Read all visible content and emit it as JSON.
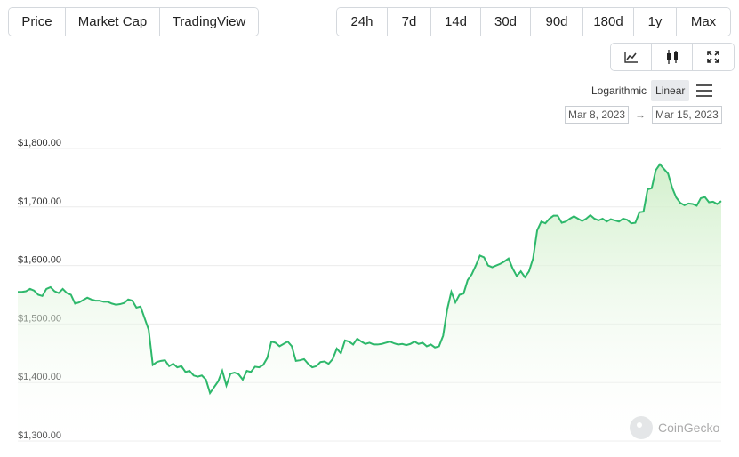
{
  "tabs": [
    {
      "label": "Price",
      "active": true
    },
    {
      "label": "Market Cap",
      "active": false
    },
    {
      "label": "TradingView",
      "active": false
    }
  ],
  "ranges": [
    {
      "label": "24h",
      "active": false
    },
    {
      "label": "7d",
      "active": true
    },
    {
      "label": "14d",
      "active": false
    },
    {
      "label": "30d",
      "active": false
    },
    {
      "label": "90d",
      "active": false
    },
    {
      "label": "180d",
      "active": false
    },
    {
      "label": "1y",
      "active": false
    },
    {
      "label": "Max",
      "active": false
    }
  ],
  "chart_types": [
    {
      "icon": "line-chart-icon",
      "active": true
    },
    {
      "icon": "candlestick-icon",
      "active": false
    },
    {
      "icon": "fullscreen-icon",
      "active": false
    }
  ],
  "scale": {
    "logarithmic": "Logarithmic",
    "linear": "Linear",
    "selected": "Linear"
  },
  "date_range": {
    "from": "Mar 8, 2023",
    "arrow": "→",
    "to": "Mar 15, 2023"
  },
  "watermark": "CoinGecko",
  "colors": {
    "line": "#2eb86b",
    "area_top": "#cdeec6",
    "accent_active": "#6aa84f"
  },
  "chart_data": {
    "type": "area",
    "title": "",
    "xlabel": "",
    "ylabel": "",
    "ylim": [
      1300,
      1800
    ],
    "yticks": [
      1300,
      1400,
      1500,
      1600,
      1700,
      1800
    ],
    "ytick_labels": [
      "$1,300.00",
      "$1,400.00",
      "$1,500.00",
      "$1,600.00",
      "$1,700.00",
      "$1,800.00"
    ],
    "x_start": "Mar 8, 2023",
    "x_end": "Mar 15, 2023",
    "grid": true,
    "series": [
      {
        "values": [
          1555,
          1555,
          1556,
          1560,
          1557,
          1550,
          1548,
          1560,
          1563,
          1556,
          1553,
          1560,
          1553,
          1550,
          1535,
          1537,
          1541,
          1545,
          1542,
          1540,
          1540,
          1538,
          1538,
          1535,
          1533,
          1534,
          1536,
          1542,
          1540,
          1528,
          1530,
          1510,
          1490,
          1430,
          1435,
          1437,
          1438,
          1428,
          1432,
          1426,
          1428,
          1418,
          1420,
          1412,
          1410,
          1412,
          1405,
          1382,
          1392,
          1402,
          1420,
          1395,
          1415,
          1417,
          1414,
          1405,
          1420,
          1418,
          1427,
          1426,
          1430,
          1442,
          1470,
          1468,
          1462,
          1466,
          1470,
          1462,
          1437,
          1438,
          1440,
          1432,
          1426,
          1428,
          1435,
          1436,
          1432,
          1440,
          1458,
          1450,
          1472,
          1470,
          1465,
          1475,
          1470,
          1466,
          1468,
          1465,
          1465,
          1466,
          1468,
          1470,
          1467,
          1465,
          1466,
          1464,
          1466,
          1470,
          1466,
          1468,
          1462,
          1465,
          1460,
          1462,
          1480,
          1525,
          1555,
          1537,
          1550,
          1552,
          1575,
          1585,
          1600,
          1617,
          1614,
          1600,
          1597,
          1600,
          1603,
          1607,
          1612,
          1595,
          1582,
          1590,
          1580,
          1590,
          1612,
          1660,
          1675,
          1672,
          1680,
          1685,
          1685,
          1673,
          1675,
          1680,
          1684,
          1680,
          1676,
          1680,
          1686,
          1680,
          1677,
          1680,
          1675,
          1679,
          1677,
          1675,
          1680,
          1678,
          1672,
          1673,
          1691,
          1692,
          1730,
          1732,
          1763,
          1773,
          1765,
          1757,
          1733,
          1716,
          1707,
          1703,
          1706,
          1705,
          1702,
          1715,
          1717,
          1708,
          1709,
          1705,
          1710
        ],
        "color": "#2eb86b"
      }
    ]
  }
}
